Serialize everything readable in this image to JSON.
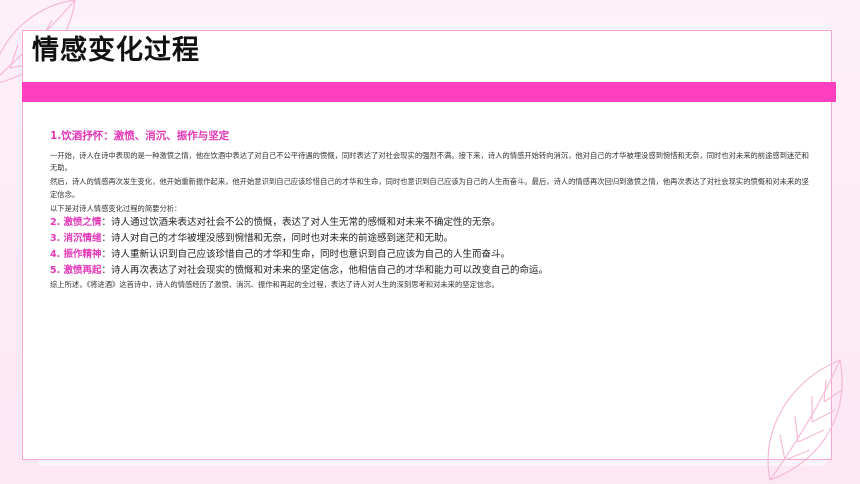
{
  "page": {
    "title": "情感变化过程"
  },
  "content": {
    "heading": "1.饮酒抒怀：激愤、消沉、振作与坚定",
    "para1": "一开始，诗人在诗中表现的是一种激愤之情，他在饮酒中表达了对自己不公平待遇的愤慨，同时表达了对社会现实的强烈不满。接下来，诗人的情感开始转向消沉，他对自己的才华被埋没感到惋惜和无奈，同时也对未来的前途感到迷茫和无助。",
    "para2": "然后，诗人的情感再次发生变化，他开始重新振作起来，他开始意识到自己应该珍惜自己的才华和生命，同时也意识到自己应该为自己的人生而奋斗。最后，诗人的情感再次回归到激愤之情，他再次表达了对社会现实的愤慨和对未来的坚定信念。",
    "intro": "以下是对诗人情感变化过程的简要分析：",
    "items": [
      {
        "key": "2. 激愤之情",
        "text": "：诗人通过饮酒来表达对社会不公的愤慨，表达了对人生无常的感慨和对未来不确定性的无奈。"
      },
      {
        "key": "3. 消沉情绪",
        "text": "：诗人对自己的才华被埋没感到惋惜和无奈，同时也对未来的前途感到迷茫和无助。"
      },
      {
        "key": "4. 振作精神",
        "text": "：诗人重新认识到自己应该珍惜自己的才华和生命，同时也意识到自己应该为自己的人生而奋斗。"
      },
      {
        "key": "5. 激愤再起",
        "text": "：诗人再次表达了对社会现实的愤慨和对未来的坚定信念，他相信自己的才华和能力可以改变自己的命运。"
      }
    ],
    "summary": "综上所述，《将进酒》这首诗中，诗人的情感经历了激愤、消沉、振作和再起的全过程，表达了诗人对人生的深刻思考和对未来的坚定信念。"
  },
  "colors": {
    "accent": "#ff3fc0",
    "heading": "#e43ab8",
    "border": "#f7a6d3",
    "background": "#fce9f4"
  },
  "icons": [
    "leaf-outline-top-left",
    "leaf-outline-bottom-right"
  ]
}
